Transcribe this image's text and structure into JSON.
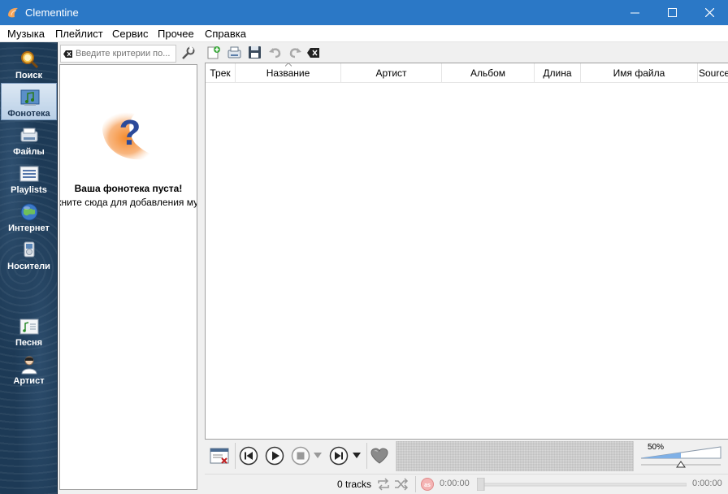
{
  "window": {
    "title": "Clementine",
    "accent_color": "#2b78c6"
  },
  "menu": {
    "items": [
      {
        "label": "Музыка"
      },
      {
        "label": "Плейлист"
      },
      {
        "label": "Сервис"
      },
      {
        "label": "Прочее"
      },
      {
        "label": "Справка"
      }
    ]
  },
  "sidebar": {
    "items": [
      {
        "label": "Поиск",
        "icon": "search-icon",
        "active": false
      },
      {
        "label": "Фонотека",
        "icon": "library-icon",
        "active": true
      },
      {
        "label": "Файлы",
        "icon": "files-icon",
        "active": false
      },
      {
        "label": "Playlists",
        "icon": "playlists-icon",
        "active": false
      },
      {
        "label": "Интернет",
        "icon": "internet-icon",
        "active": false
      },
      {
        "label": "Носители",
        "icon": "devices-icon",
        "active": false
      },
      {
        "label": "Песня",
        "icon": "song-info-icon",
        "active": false
      },
      {
        "label": "Артист",
        "icon": "artist-info-icon",
        "active": false
      }
    ]
  },
  "library": {
    "filter_placeholder": "Введите критерии по...",
    "empty_title": "Ваша фонотека пуста!",
    "empty_hint": "Щелкните сюда для добавления музыки"
  },
  "playlist": {
    "toolbar_icons": [
      "add-playlist-icon",
      "load-playlist-icon",
      "save-playlist-icon",
      "undo-icon",
      "redo-icon",
      "clear-playlist-icon"
    ],
    "columns": [
      {
        "label": "Трек"
      },
      {
        "label": "Название"
      },
      {
        "label": "Артист"
      },
      {
        "label": "Альбом"
      },
      {
        "label": "Длина"
      },
      {
        "label": "Имя файла"
      },
      {
        "label": "Source"
      }
    ],
    "sorted_column": "Название"
  },
  "player": {
    "volume_label": "50%",
    "volume_value": 0.5,
    "tracks_text": "0 tracks",
    "time_elapsed": "0:00:00",
    "time_total": "0:00:00"
  }
}
